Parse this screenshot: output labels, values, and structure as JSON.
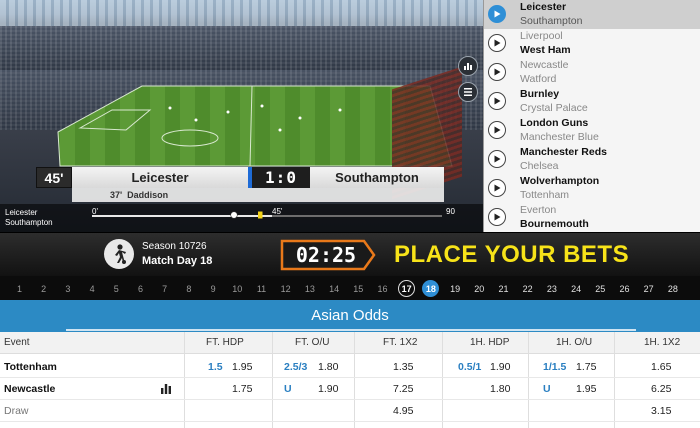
{
  "video": {
    "minute": "45'",
    "home_team": "Leicester",
    "score": "1:0",
    "away_team": "Southampton",
    "goal_minute": "37'",
    "goal_scorer": "Daddison",
    "timeline": {
      "home_label": "Leicester",
      "away_label": "Southampton",
      "start": "0'",
      "half": "45'",
      "end": "90",
      "progress_minutes": 45
    },
    "icons": [
      "stats-icon",
      "list-icon"
    ]
  },
  "match_list": [
    {
      "home": "Leicester",
      "away": "Southampton",
      "active": true
    },
    {
      "home": "Liverpool",
      "away": "West Ham",
      "active": false,
      "bold": "away"
    },
    {
      "home": "Newcastle",
      "away": "Watford",
      "active": false,
      "bold": "none"
    },
    {
      "home": "Burnley",
      "away": "Crystal Palace",
      "active": false,
      "bold": "home"
    },
    {
      "home": "London Guns",
      "away": "Manchester Blue",
      "active": false,
      "bold": "home"
    },
    {
      "home": "Manchester Reds",
      "away": "Chelsea",
      "active": false,
      "bold": "home"
    },
    {
      "home": "Wolverhampton",
      "away": "Tottenham",
      "active": false,
      "bold": "home"
    },
    {
      "home": "Everton",
      "away": "Bournemouth",
      "active": false,
      "bold": "away"
    }
  ],
  "bet_bar": {
    "season": "Season 10726",
    "match_day": "Match Day 18",
    "countdown": "02:25",
    "title": "PLACE YOUR BETS"
  },
  "match_days": {
    "days": [
      1,
      2,
      3,
      4,
      5,
      6,
      7,
      8,
      9,
      10,
      11,
      12,
      13,
      14,
      15,
      16,
      17,
      18,
      19,
      20,
      21,
      22,
      23,
      24,
      25,
      26,
      27,
      28
    ],
    "previous": 17,
    "current": 18
  },
  "odds": {
    "title": "Asian Odds",
    "columns": [
      "Event",
      "FT. HDP",
      "FT. O/U",
      "FT. 1X2",
      "1H. HDP",
      "1H. O/U",
      "1H. 1X2"
    ],
    "rows": [
      {
        "event": "Tottenham",
        "ft_hdp_line": "1.5",
        "ft_hdp": "1.95",
        "ft_ou_line": "2.5/3",
        "ft_ou": "1.80",
        "ft_1x2": "1.35",
        "h1_hdp_line": "0.5/1",
        "h1_hdp": "1.90",
        "h1_ou_line": "1/1.5",
        "h1_ou": "1.75",
        "h1_1x2": "1.65"
      },
      {
        "event": "Newcastle",
        "ft_hdp_line": "",
        "ft_hdp": "1.75",
        "ft_ou_line": "U",
        "ft_ou": "1.90",
        "ft_1x2": "7.25",
        "h1_hdp_line": "",
        "h1_hdp": "1.80",
        "h1_ou_line": "U",
        "h1_ou": "1.95",
        "h1_1x2": "6.25"
      },
      {
        "event": "Draw",
        "ft_hdp_line": "",
        "ft_hdp": "",
        "ft_ou_line": "",
        "ft_ou": "",
        "ft_1x2": "4.95",
        "h1_hdp_line": "",
        "h1_hdp": "",
        "h1_ou_line": "",
        "h1_ou": "",
        "h1_1x2": "3.15"
      }
    ]
  }
}
